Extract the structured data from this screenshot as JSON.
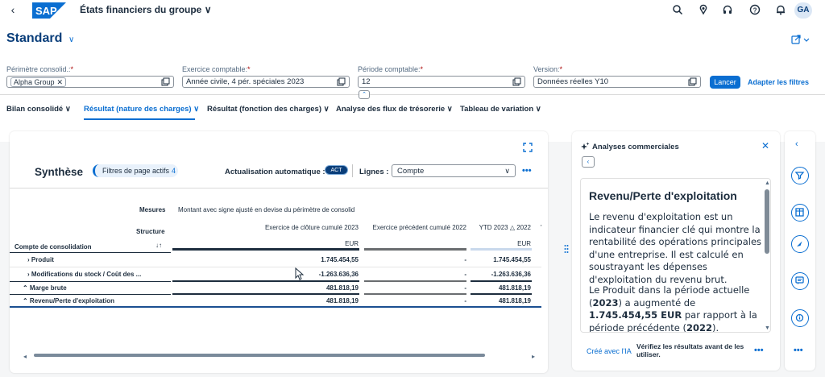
{
  "shell": {
    "back": "‹",
    "logo": "SAP",
    "app_title": "États financiers du groupe ∨",
    "avatar": "GA",
    "icons": [
      "search-icon",
      "lightbulb-icon",
      "headset-icon",
      "help-icon",
      "bell-icon"
    ]
  },
  "header": {
    "variant": "Standard",
    "variant_chevron": "∨",
    "filters": [
      {
        "label": "Périmètre consolid.:",
        "required": "*",
        "token": "Alpha Group",
        "value": ""
      },
      {
        "label": "Exercice comptable:",
        "required": "*",
        "value": "Année civile, 4 pér. spéciales 2023"
      },
      {
        "label": "Période comptable:",
        "required": "*",
        "value": "12"
      },
      {
        "label": "Version:",
        "required": "*",
        "value": "Données réelles Y10"
      }
    ],
    "go": "Lancer",
    "adapt": "Adapter les filtres",
    "collapse": "⌃"
  },
  "tabs": [
    {
      "label": "Bilan consolidé ∨"
    },
    {
      "label": "Résultat (nature des charges) ∨"
    },
    {
      "label": "Résultat (fonction des charges) ∨"
    },
    {
      "label": "Analyse des flux de trésorerie ∨"
    },
    {
      "label": "Tableau de variation ∨"
    }
  ],
  "main": {
    "title": "Synthèse",
    "page_filters": "Filtres de page actifs",
    "page_filters_count": "4",
    "auto_label": "Actualisation automatique :",
    "auto_switch": "ACT",
    "rows_label": "Lignes :",
    "rows_value": "Compte",
    "more": "•••",
    "table": {
      "measures_label": "Mesures",
      "measures_value": "Montant avec signe ajusté en devise du périmètre de consolid",
      "structure_label": "Structure",
      "account_label": "Compte de consolidation",
      "sort_icon": "↓↑",
      "col1": "Exercice de clôture cumulé 2023",
      "col2": "Exercice précédent cumulé 2022",
      "col3": "YTD 2023 △ 2022",
      "col3_more": "'",
      "unit1": "EUR",
      "unit3": "EUR",
      "rows": [
        {
          "label": "› Produit",
          "v1": "1.745.454,55",
          "v2": "-",
          "v3": "1.745.454,55"
        },
        {
          "label": "› Modifications du stock / Coût des ...",
          "v1": "-1.263.636,36",
          "v2": "-",
          "v3": "-1.263.636,36"
        },
        {
          "label": "⌃ Marge brute",
          "v1": "481.818,19",
          "v2": "-",
          "v3": "481.818,19"
        },
        {
          "label": "⌃ Revenu/Perte d'exploitation",
          "v1": "481.818,19",
          "v2": "-",
          "v3": "481.818,19"
        }
      ]
    }
  },
  "ai": {
    "title": "Analyses commerciales",
    "close": "✕",
    "back": "‹",
    "heading": "Revenu/Perte d'exploitation",
    "para1": "Le revenu d'exploitation est un indicateur financier clé qui montre la rentabilité des opérations principales d'une entreprise. Il est calculé en soustrayant les dépenses d'exploitation du revenu brut.",
    "para2_a": "Le Produit dans la période actuelle (",
    "para2_b": "2023",
    "para2_c": ") a augmenté de ",
    "para2_d": "1.745.454,55 EUR",
    "para2_e": " par rapport à la période précédente (",
    "para2_f": "2022",
    "para2_g": ").",
    "created": "Créé avec l'IA",
    "verify": "Vérifiez les résultats avant de les utiliser.",
    "more": "•••"
  },
  "rail": {
    "chevron": "‹",
    "more": "•••",
    "icons": [
      "filter-icon",
      "table-icon",
      "compass-icon",
      "comment-icon",
      "info-icon"
    ]
  },
  "colors": {
    "accent": "#0a6ed1",
    "dark_blue": "#0a3e7a",
    "text": "#1d2d3e"
  }
}
